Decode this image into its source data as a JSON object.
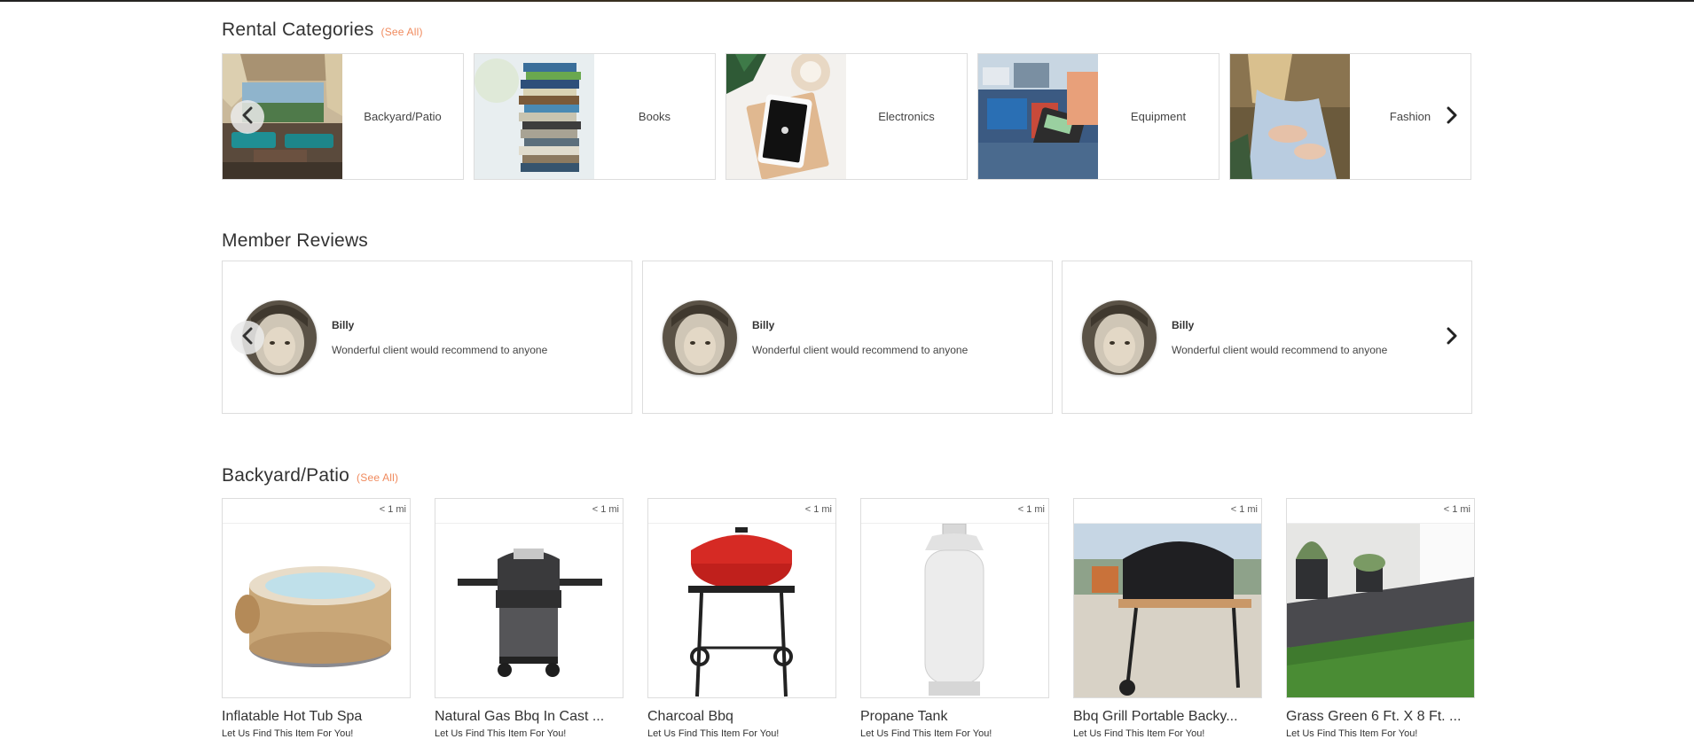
{
  "categories_section": {
    "title": "Rental Categories",
    "see_all": "(See All)",
    "items": [
      {
        "label": "Backyard/Patio",
        "image": "patio-photo"
      },
      {
        "label": "Books",
        "image": "books-photo"
      },
      {
        "label": "Electronics",
        "image": "tablet-photo"
      },
      {
        "label": "Equipment",
        "image": "equipment-photo"
      },
      {
        "label": "Fashion",
        "image": "fashion-photo"
      }
    ]
  },
  "reviews_section": {
    "title": "Member Reviews",
    "items": [
      {
        "name": "Billy",
        "text": "Wonderful client would recommend to anyone"
      },
      {
        "name": "Billy",
        "text": "Wonderful client would recommend to anyone"
      },
      {
        "name": "Billy",
        "text": "Wonderful client would recommend to anyone"
      }
    ]
  },
  "products_section": {
    "title": "Backyard/Patio",
    "see_all": "(See All)",
    "items": [
      {
        "distance": "< 1 mi",
        "title": "Inflatable Hot Tub Spa",
        "subtitle": "Let Us Find This Item For You!"
      },
      {
        "distance": "< 1 mi",
        "title": "Natural Gas Bbq In Cast ...",
        "subtitle": "Let Us Find This Item For You!"
      },
      {
        "distance": "< 1 mi",
        "title": "Charcoal Bbq",
        "subtitle": "Let Us Find This Item For You!"
      },
      {
        "distance": "< 1 mi",
        "title": "Propane Tank",
        "subtitle": "Let Us Find This Item For You!"
      },
      {
        "distance": "< 1 mi",
        "title": "Bbq Grill Portable Backy...",
        "subtitle": "Let Us Find This Item For You!"
      },
      {
        "distance": "< 1 mi",
        "title": "Grass Green 6 Ft. X 8 Ft. ...",
        "subtitle": "Let Us Find This Item For You!"
      }
    ]
  },
  "colors": {
    "accent": "#f08a5d",
    "border": "#dddddd",
    "text": "#333333"
  },
  "icons": {
    "prev": "chevron-left-icon",
    "next": "chevron-right-icon"
  }
}
